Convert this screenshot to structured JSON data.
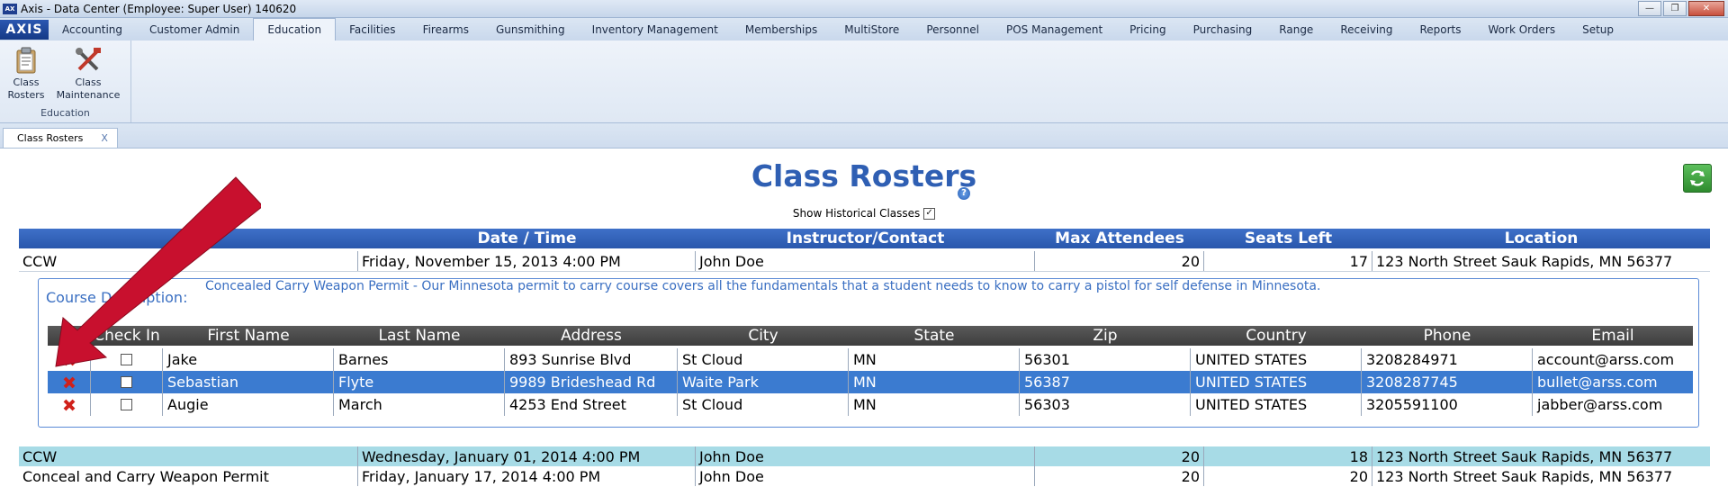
{
  "window": {
    "title": "Axis - Data Center  (Employee: Super User) 140620"
  },
  "menu": {
    "logo": "AXIS",
    "tabs": [
      "Accounting",
      "Customer Admin",
      "Education",
      "Facilities",
      "Firearms",
      "Gunsmithing",
      "Inventory Management",
      "Memberships",
      "MultiStore",
      "Personnel",
      "POS Management",
      "Pricing",
      "Purchasing",
      "Range",
      "Receiving",
      "Reports",
      "Work Orders",
      "Setup"
    ],
    "active": "Education"
  },
  "ribbon": {
    "btn1_line1": "Class",
    "btn1_line2": "Rosters",
    "btn2_line1": "Class",
    "btn2_line2": "Maintenance",
    "group_label": "Education"
  },
  "doc_tab": {
    "label": "Class Rosters",
    "close": "X"
  },
  "page": {
    "title": "Class Rosters",
    "help": "?",
    "show_historical": "Show Historical Classes",
    "show_historical_checked": true
  },
  "classes_header": [
    "",
    "Date / Time",
    "Instructor/Contact",
    "Max Attendees",
    "Seats Left",
    "Location"
  ],
  "classes": [
    {
      "name": "CCW",
      "date": "Friday, November 15, 2013 4:00 PM",
      "instructor": "John Doe",
      "max": "20",
      "seats": "17",
      "location": "123 North Street Sauk Rapids, MN 56377"
    },
    {
      "name": "CCW",
      "date": "Wednesday, January 01, 2014 4:00 PM",
      "instructor": "John Doe",
      "max": "20",
      "seats": "18",
      "location": "123 North Street Sauk Rapids, MN 56377"
    },
    {
      "name": "Conceal and Carry Weapon Permit",
      "date": "Friday, January 17, 2014 4:00 PM",
      "instructor": "John Doe",
      "max": "20",
      "seats": "20",
      "location": "123 North Street Sauk Rapids, MN 56377"
    }
  ],
  "detail": {
    "course_label": "Course Description:",
    "course_text": "Concealed Carry Weapon Permit - Our Minnesota permit to carry course covers all the fundamentals that a student needs to know to carry a pistol for self defense in Minnesota."
  },
  "roster_header": [
    "",
    "Check In",
    "First Name",
    "Last Name",
    "Address",
    "City",
    "State",
    "Zip",
    "Country",
    "Phone",
    "Email"
  ],
  "roster": [
    {
      "first": "Jake",
      "last": "Barnes",
      "address": "893 Sunrise Blvd",
      "city": "St Cloud",
      "state": "MN",
      "zip": "56301",
      "country": "UNITED STATES",
      "phone": "3208284971",
      "email": "account@arss.com"
    },
    {
      "first": "Sebastian",
      "last": "Flyte",
      "address": "9989 Brideshead Rd",
      "city": "Waite Park",
      "state": "MN",
      "zip": "56387",
      "country": "UNITED STATES",
      "phone": "3208287745",
      "email": "bullet@arss.com"
    },
    {
      "first": "Augie",
      "last": "March",
      "address": "4253 End Street",
      "city": "St Cloud",
      "state": "MN",
      "zip": "56303",
      "country": "UNITED STATES",
      "phone": "3205591100",
      "email": "jabber@arss.com"
    }
  ],
  "colors": {
    "accent": "#2f5fb3",
    "header_blue": "#2957ac",
    "selected_row": "#3b7bd0",
    "alt_row": "#a7dbe6"
  }
}
